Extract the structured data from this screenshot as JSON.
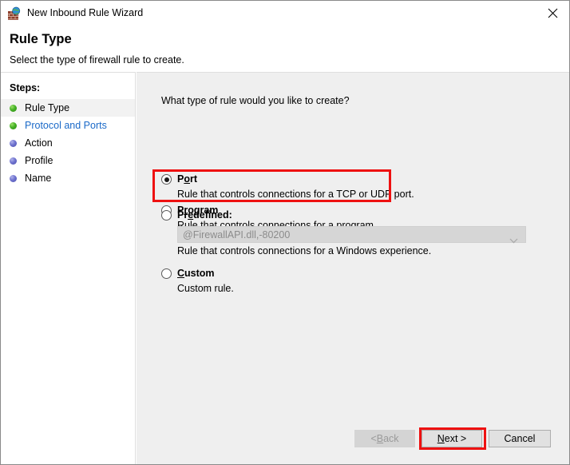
{
  "window": {
    "title": "New Inbound Rule Wizard",
    "icon": "firewall-globe-icon",
    "close_label": "✕"
  },
  "header": {
    "title": "Rule Type",
    "subtitle": "Select the type of firewall rule to create."
  },
  "sidebar": {
    "heading": "Steps:",
    "items": [
      {
        "label": "Rule Type",
        "bullet": "green",
        "state": "current"
      },
      {
        "label": "Protocol and Ports",
        "bullet": "green",
        "state": "link"
      },
      {
        "label": "Action",
        "bullet": "blue",
        "state": "pending"
      },
      {
        "label": "Profile",
        "bullet": "blue",
        "state": "pending"
      },
      {
        "label": "Name",
        "bullet": "blue",
        "state": "pending"
      }
    ]
  },
  "main": {
    "question": "What type of rule would you like to create?",
    "options": [
      {
        "key": "program",
        "title_pre": "P",
        "title_accel": "r",
        "title_post": "ogram",
        "description": "Rule that controls connections for a program.",
        "selected": false
      },
      {
        "key": "port",
        "title_pre": "P",
        "title_accel": "o",
        "title_post": "rt",
        "description": "Rule that controls connections for a TCP or UDP port.",
        "selected": true
      },
      {
        "key": "predefined",
        "title_pre": "Pr",
        "title_accel": "e",
        "title_post": "defined:",
        "description": "Rule that controls connections for a Windows experience.",
        "selected": false,
        "combo_value": "@FirewallAPI.dll,-80200",
        "combo_disabled": true
      },
      {
        "key": "custom",
        "title_pre": "",
        "title_accel": "C",
        "title_post": "ustom",
        "description": "Custom rule.",
        "selected": false
      }
    ]
  },
  "footer": {
    "back": {
      "label_pre": "< ",
      "label_accel": "B",
      "label_post": "ack",
      "disabled": true
    },
    "next": {
      "label_pre": "",
      "label_accel": "N",
      "label_post": "ext >",
      "disabled": false
    },
    "cancel": {
      "label": "Cancel",
      "disabled": false
    }
  },
  "annotations": {
    "highlight_color": "#ee1111",
    "highlighted": [
      "port-option",
      "next-button"
    ]
  }
}
